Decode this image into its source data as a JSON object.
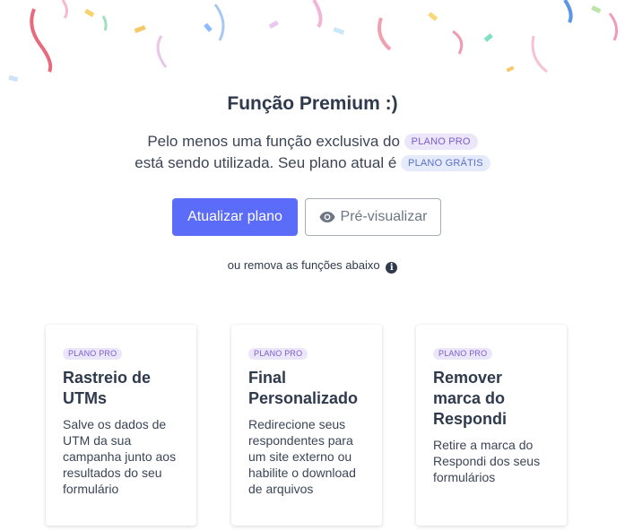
{
  "header": {
    "title": "Função Premium :)",
    "description_line1": "Pelo menos uma função exclusiva do",
    "description_badge1": "PLANO PRO",
    "description_line2": "está sendo utilizada. Seu plano atual é",
    "description_badge2": "PLANO GRÁTIS"
  },
  "actions": {
    "upgrade_label": "Atualizar plano",
    "preview_label": "Pré-visualizar",
    "remove_text": "ou remova as funções abaixo"
  },
  "icons": {
    "preview": "eye-icon",
    "info": "info-icon"
  },
  "colors": {
    "primary": "#5b6cf9",
    "badge_pro_bg": "#ece6fb",
    "badge_pro_text": "#7b5cc9",
    "badge_free_bg": "#e6ebfb",
    "badge_free_text": "#5a6fc6"
  },
  "features": [
    {
      "badge": "PLANO PRO",
      "title": "Rastreio de UTMs",
      "description": "Salve os dados de UTM da sua campanha junto aos resultados do seu formulário"
    },
    {
      "badge": "PLANO PRO",
      "title": "Final Personalizado",
      "description": "Redirecione seus respondentes para um site externo ou habilite o download de arquivos"
    },
    {
      "badge": "PLANO PRO",
      "title": "Remover marca do Respondi",
      "description": "Retire a marca do Respondi dos seus formulários"
    }
  ]
}
